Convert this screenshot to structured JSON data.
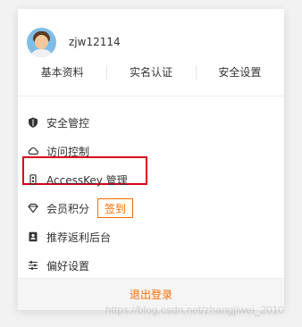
{
  "user": {
    "name": "zjw12114"
  },
  "tabs": [
    {
      "label": "基本资料"
    },
    {
      "label": "实名认证"
    },
    {
      "label": "安全设置"
    }
  ],
  "menu": [
    {
      "label": "安全管控",
      "icon": "shield-icon"
    },
    {
      "label": "访问控制",
      "icon": "cloud-icon"
    },
    {
      "label": "AccessKey 管理",
      "icon": "key-icon"
    },
    {
      "label": "会员积分",
      "icon": "diamond-icon",
      "action": "签到"
    },
    {
      "label": "推荐返利后台",
      "icon": "contact-icon"
    },
    {
      "label": "偏好设置",
      "icon": "sliders-icon"
    }
  ],
  "footer": {
    "logout": "退出登录"
  },
  "watermark": "https://blog.csdn.net/zhangjiwei_2010",
  "colors": {
    "accent": "#ff6a00",
    "highlight": "#d9001b"
  }
}
